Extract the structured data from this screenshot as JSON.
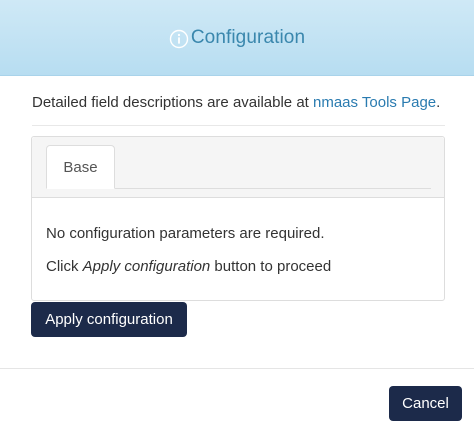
{
  "header": {
    "title": "Configuration",
    "icon": "info-circle-icon",
    "accent_color": "#3a87ad"
  },
  "description": {
    "text": "Detailed field descriptions are available at ",
    "link_text": "nmaas Tools Page",
    "suffix": "."
  },
  "tabs": [
    {
      "label": "Base",
      "active": true
    }
  ],
  "panel": {
    "message": "No configuration parameters are required.",
    "instruction_prefix": "Click ",
    "instruction_emphasis": "Apply configuration",
    "instruction_suffix": " button to proceed"
  },
  "buttons": {
    "apply_label": "Apply configuration",
    "cancel_label": "Cancel",
    "button_color": "#1c2a4a"
  }
}
